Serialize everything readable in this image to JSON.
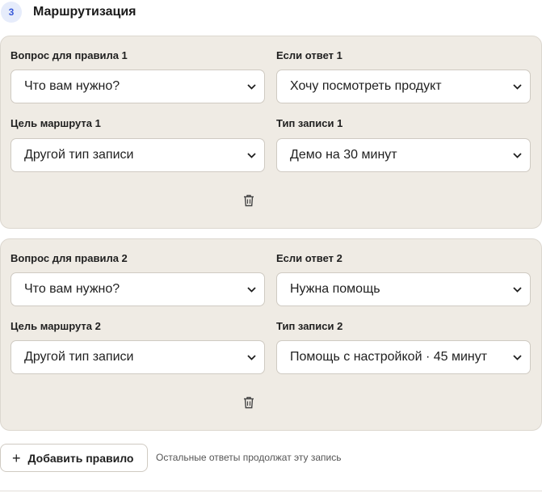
{
  "section": {
    "step": "3",
    "title": "Маршрутизация"
  },
  "rules": [
    {
      "question_label": "Вопрос для правила 1",
      "question_value": "Что вам нужно?",
      "answer_label": "Если ответ 1",
      "answer_value": "Хочу посмотреть продукт",
      "target_label": "Цель маршрута 1",
      "target_value": "Другой тип записи",
      "type_label": "Тип записи 1",
      "type_value": "Демо на 30 минут"
    },
    {
      "question_label": "Вопрос для правила 2",
      "question_value": "Что вам нужно?",
      "answer_label": "Если ответ 2",
      "answer_value": "Нужна помощь",
      "target_label": "Цель маршрута 2",
      "target_value": "Другой тип записи",
      "type_label": "Тип записи 2",
      "type_value": "Помощь с настройкой · 45 минут"
    }
  ],
  "icons": {
    "select_chevron": "chevron-down-icon",
    "delete": "trash-icon",
    "add": "plus-icon"
  },
  "add_rule": {
    "icon": "+",
    "label": "Добавить правило"
  },
  "hint": "Остальные ответы продолжат эту запись",
  "colors": {
    "card_bg": "#efebe4",
    "badge_bg": "#e6ecfb",
    "badge_text": "#3a5bd9"
  }
}
